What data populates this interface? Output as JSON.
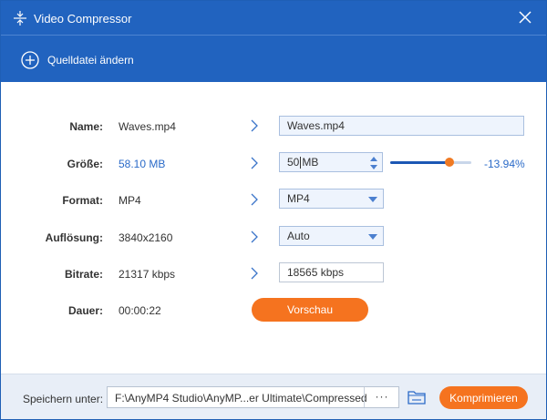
{
  "window": {
    "title": "Video Compressor"
  },
  "toolbar": {
    "add_source_label": "Quelldatei ändern"
  },
  "rows": {
    "name": {
      "label": "Name:",
      "value": "Waves.mp4",
      "input_value": "Waves.mp4"
    },
    "size": {
      "label": "Größe:",
      "value": "58.10 MB",
      "input_value_before_caret": "50",
      "input_value_after_caret": " MB",
      "slider_fraction": 0.73,
      "percent": "-13.94%"
    },
    "format": {
      "label": "Format:",
      "value": "MP4",
      "selected": "MP4"
    },
    "resolution": {
      "label": "Auflösung:",
      "value": "3840x2160",
      "selected": "Auto"
    },
    "bitrate": {
      "label": "Bitrate:",
      "value": "21317 kbps",
      "input_value": "18565 kbps"
    },
    "duration": {
      "label": "Dauer:",
      "value": "00:00:22"
    }
  },
  "preview_button": "Vorschau",
  "footer": {
    "save_label": "Speichern unter:",
    "path": "F:\\AnyMP4 Studio\\AnyMP...er Ultimate\\Compressed",
    "browse_label": "···",
    "compress_button": "Komprimieren"
  },
  "colors": {
    "header": "#2163bf",
    "accent": "#f5731f",
    "link": "#2a6ac8"
  },
  "icons": [
    "compress-icon",
    "close-icon",
    "plus-circle-icon",
    "chevron-right-icon",
    "chevron-down-icon",
    "folder-icon"
  ]
}
